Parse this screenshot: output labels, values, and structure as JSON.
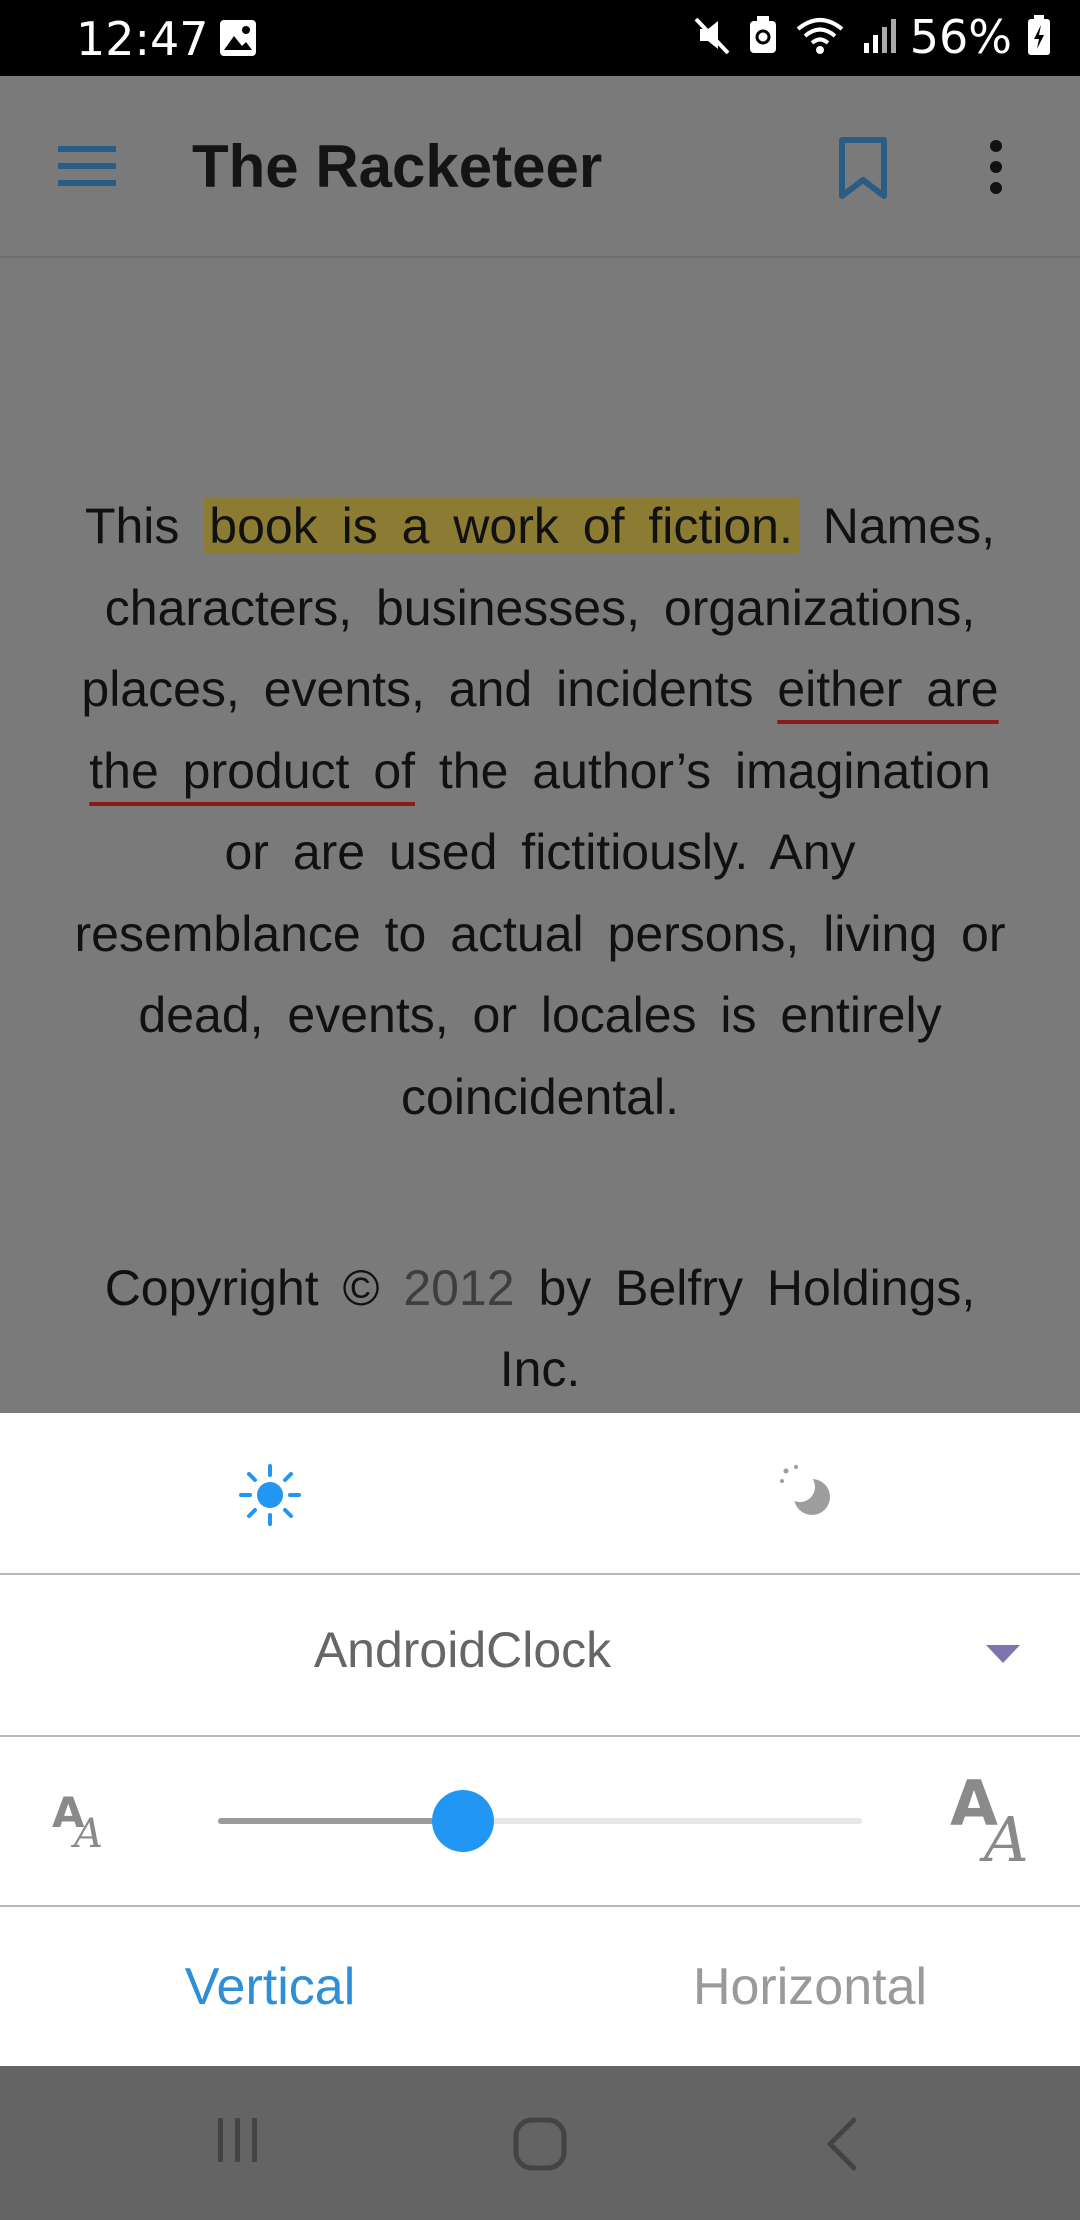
{
  "status_bar": {
    "time": "12:47",
    "battery": "56%"
  },
  "app_bar": {
    "title": "The Racketeer"
  },
  "page": {
    "text_before_highlight": "This ",
    "highlighted_text": "book is a work of fiction.",
    "text_mid": " Names, characters, businesses, organizations, places, events, and incidents ",
    "underlined_text": "either are the product of",
    "text_after": " the author’s imagination or are used fictitiously. Any resemblance to actual persons, living or dead, events, or locales is entirely coincidental.",
    "copyright_prefix": "Copyright © ",
    "copyright_year": "2012",
    "copyright_suffix": " by Belfry Holdings, Inc."
  },
  "settings": {
    "font_name": "AndroidClock",
    "text_size_level": 0.38,
    "orientation_vertical": "Vertical",
    "orientation_horizontal": "Horizontal"
  },
  "colors": {
    "accent": "#2196f3",
    "highlight": "#8b7b33",
    "underline": "#8b1a1a",
    "dropdown_arrow": "#7f74ad"
  }
}
